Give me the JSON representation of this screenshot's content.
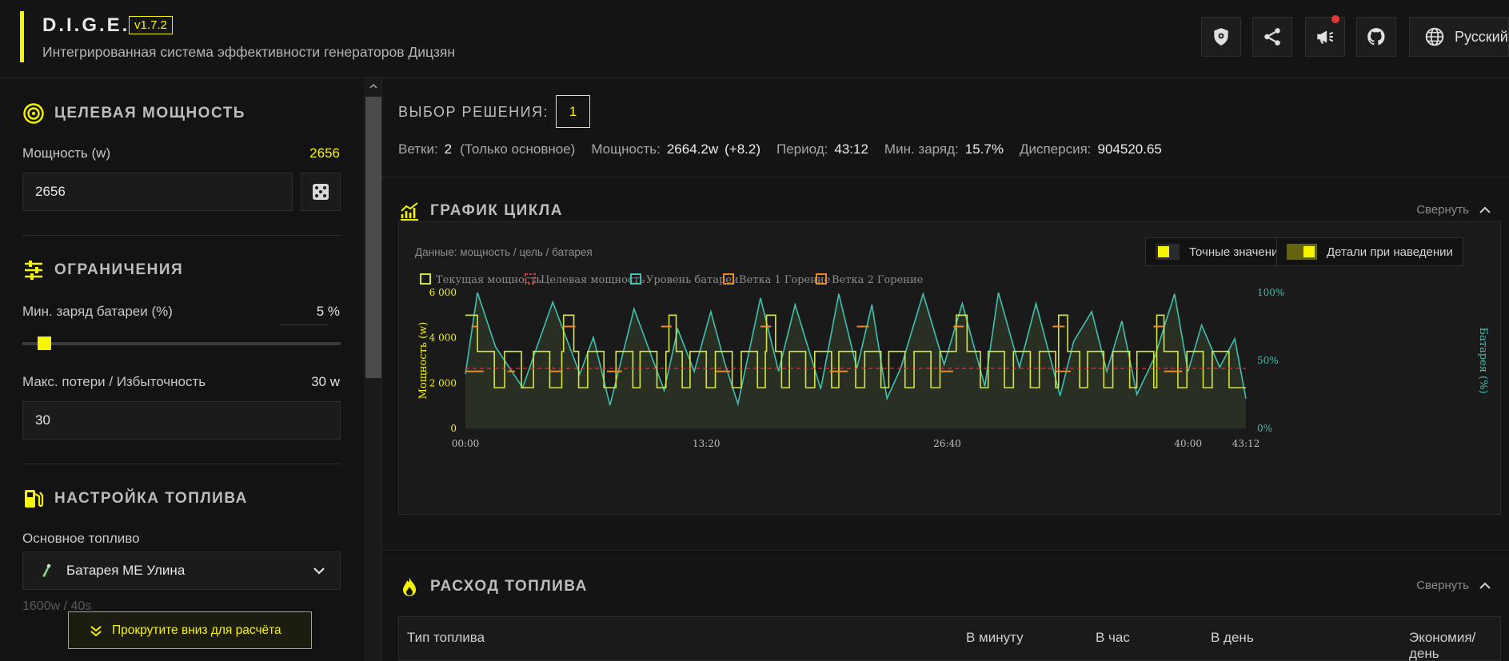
{
  "header": {
    "title": "D.I.G.E.",
    "version": "v1.7.2",
    "subtitle": "Интегрированная система эффективности генераторов Дицзян",
    "language": "Русский",
    "accent": "#f5f500"
  },
  "sidebar": {
    "target": {
      "title": "ЦЕЛЕВАЯ МОЩНОСТЬ",
      "power_label": "Мощность (w)",
      "power_display": "2656",
      "power_input": "2656"
    },
    "limits": {
      "title": "ОГРАНИЧЕНИЯ",
      "min_charge_label": "Мин. заряд батареи (%)",
      "min_charge_value": "5 %",
      "min_charge_fraction": 0.05,
      "max_loss_label": "Макс. потери / Избыточность",
      "max_loss_value": "30 w",
      "max_loss_input": "30"
    },
    "fuel": {
      "title": "НАСТРОЙКА ТОПЛИВА",
      "main_fuel_label": "Основное топливо",
      "main_fuel_value": "Батарея МЕ Улина",
      "fuel_info": "1600w / 40s"
    },
    "scroll_hint": "Прокрутите вниз для расчёта"
  },
  "solution": {
    "label": "ВЫБОР РЕШЕНИЯ:",
    "selected": "1",
    "stats": {
      "branches_label": "Ветки:",
      "branches_value": "2",
      "branches_note": "(Только основное)",
      "power_label": "Мощность:",
      "power_value": "2664.2w",
      "power_delta": "(+8.2)",
      "period_label": "Период:",
      "period_value": "43:12",
      "min_charge_label": "Мин. заряд:",
      "min_charge_value": "15.7%",
      "dispersion_label": "Дисперсия:",
      "dispersion_value": "904520.65"
    }
  },
  "cycle_chart": {
    "title": "ГРАФИК ЦИКЛА",
    "collapse_label": "Свернуть",
    "note": "Данные: мощность / цель / батарея",
    "toggle_exact": "Точные значения",
    "toggle_hover": "Детали при наведении",
    "legend": [
      "Текущая мощность",
      "Целевая мощность",
      "Уровень батареи",
      "Ветка 1 Горение",
      "Ветка 2 Горение"
    ]
  },
  "chart_data": {
    "type": "line",
    "ylabel": "Мощность (w)",
    "y2label": "Батарея (%)",
    "ylim": [
      0,
      6000
    ],
    "y2lim": [
      0,
      100
    ],
    "yticks": [
      "6 000",
      "4 000",
      "2 000",
      "0"
    ],
    "y2ticks": [
      "100%",
      "50%",
      "0%"
    ],
    "xticks": [
      "00:00",
      "13:20",
      "26:40",
      "40:00",
      "43:12"
    ],
    "xlim_seconds": [
      0,
      2592
    ],
    "target_power": 2656,
    "grid": false,
    "legend_position": "top-left",
    "colors": {
      "power": "#d4e63a",
      "target": "#c44040",
      "battery": "#3fc1b0",
      "branch1": "#e88a2c",
      "branch2": "#e88a2c"
    },
    "series": [
      {
        "name": "Текущая мощность",
        "low": 1800,
        "mid": 2520,
        "high": 3400,
        "peak": 5000,
        "pulse_starts_s": [
          40,
          130,
          225,
          320,
          405,
          500,
          580,
          665,
          745,
          830,
          915,
          995,
          1075,
          1160,
          1240,
          1325,
          1405,
          1490,
          1575,
          1655,
          1735,
          1820,
          1905,
          1985,
          2065,
          2150,
          2230,
          2310,
          2395,
          2480
        ],
        "pulse_width_s": 55,
        "peaks_s": [
          [
            0,
            40
          ],
          [
            325,
            360
          ],
          [
            675,
            700
          ],
          [
            1000,
            1030
          ],
          [
            1630,
            1665
          ],
          [
            1970,
            2000
          ],
          [
            2295,
            2320
          ]
        ],
        "drop_spans_s": [
          [
            850,
            880
          ],
          [
            1215,
            1245
          ],
          [
            1430,
            1455
          ],
          [
            1810,
            1840
          ],
          [
            2555,
            2592
          ]
        ]
      },
      {
        "name": "Уровень батареи",
        "points": [
          [
            0,
            40
          ],
          [
            40,
            100
          ],
          [
            100,
            60
          ],
          [
            190,
            30
          ],
          [
            290,
            93
          ],
          [
            380,
            40
          ],
          [
            425,
            67
          ],
          [
            480,
            17
          ],
          [
            560,
            88
          ],
          [
            660,
            28
          ],
          [
            705,
            73
          ],
          [
            760,
            42
          ],
          [
            815,
            86
          ],
          [
            860,
            49
          ],
          [
            905,
            18
          ],
          [
            980,
            96
          ],
          [
            1040,
            42
          ],
          [
            1095,
            91
          ],
          [
            1180,
            29
          ],
          [
            1240,
            99
          ],
          [
            1300,
            44
          ],
          [
            1350,
            91
          ],
          [
            1400,
            22
          ],
          [
            1445,
            44
          ],
          [
            1520,
            99
          ],
          [
            1590,
            47
          ],
          [
            1650,
            92
          ],
          [
            1725,
            31
          ],
          [
            1770,
            100
          ],
          [
            1840,
            45
          ],
          [
            1895,
            92
          ],
          [
            1975,
            24
          ],
          [
            2020,
            64
          ],
          [
            2080,
            86
          ],
          [
            2130,
            42
          ],
          [
            2180,
            79
          ],
          [
            2230,
            25
          ],
          [
            2290,
            53
          ],
          [
            2355,
            99
          ],
          [
            2400,
            42
          ],
          [
            2445,
            76
          ],
          [
            2505,
            45
          ],
          [
            2555,
            66
          ],
          [
            2592,
            22
          ]
        ]
      }
    ],
    "branch_marks_s": [
      [
        20,
        40
      ],
      [
        325,
        365
      ],
      [
        650,
        685
      ],
      [
        980,
        1015
      ],
      [
        1300,
        1340
      ],
      [
        1620,
        1655
      ],
      [
        1950,
        1990
      ],
      [
        2285,
        2320
      ]
    ],
    "branch_level": 4500,
    "branch2_marks_s": [
      [
        0,
        60
      ],
      [
        140,
        165
      ],
      [
        280,
        320
      ],
      [
        470,
        520
      ],
      [
        830,
        880
      ],
      [
        1210,
        1270
      ],
      [
        1575,
        1620
      ],
      [
        1960,
        2010
      ],
      [
        2320,
        2380
      ]
    ],
    "branch2_level": 2520
  },
  "fuel_usage": {
    "title": "РАСХОД ТОПЛИВА",
    "collapse_label": "Свернуть",
    "columns": [
      "Тип топлива",
      "В минуту",
      "В час",
      "В день",
      "Экономия/день"
    ]
  }
}
